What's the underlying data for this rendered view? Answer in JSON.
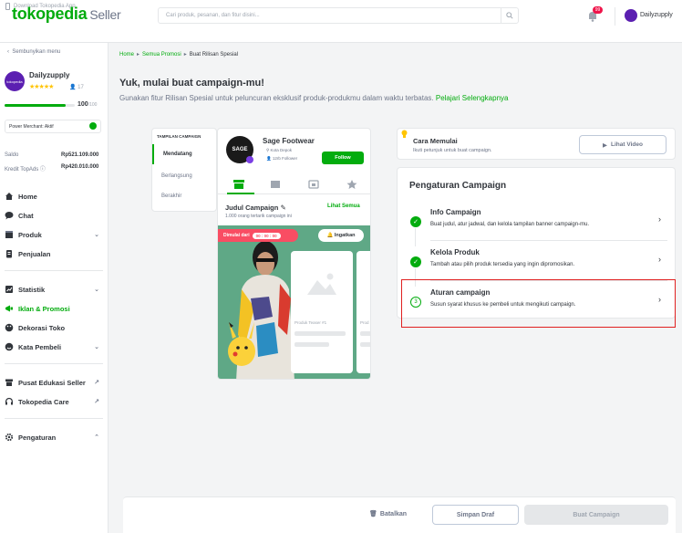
{
  "topbar": {
    "download_app": "Download Tokopedia App"
  },
  "header": {
    "logo": "tokopedia",
    "logo_suffix": "Seller",
    "search_placeholder": "Cari produk, pesanan, dan fitur disini...",
    "notification_count": "99",
    "user_name": "Dailyzupply",
    "avatar_text": "tokopedia"
  },
  "sidebar": {
    "hide_menu": "Sembunyikan menu",
    "shop_name": "Dailyzupply",
    "stars": "★★★★★",
    "followers": "17",
    "score": "100",
    "score_max": "/100",
    "power_merchant": "Power Merchant: Aktif",
    "saldo_label": "Saldo",
    "saldo_value": "Rp521.109.000",
    "kredit_label": "Kredit TopAds",
    "kredit_value": "Rp420.010.000",
    "items": [
      {
        "label": "Home",
        "icon": "home-icon"
      },
      {
        "label": "Chat",
        "icon": "chat-icon"
      },
      {
        "label": "Produk",
        "icon": "box-icon"
      },
      {
        "label": "Penjualan",
        "icon": "clipboard-icon"
      },
      {
        "label": "Statistik",
        "icon": "chart-icon"
      },
      {
        "label": "Iklan & Promosi",
        "icon": "megaphone-icon"
      },
      {
        "label": "Dekorasi Toko",
        "icon": "palette-icon"
      },
      {
        "label": "Kata Pembeli",
        "icon": "smile-icon"
      },
      {
        "label": "Pusat Edukasi Seller",
        "icon": "store-icon"
      },
      {
        "label": "Tokopedia Care",
        "icon": "headset-icon"
      },
      {
        "label": "Pengaturan",
        "icon": "gear-icon"
      }
    ]
  },
  "breadcrumb": {
    "home": "Home",
    "semua_promosi": "Semua Promosi",
    "current": "Buat Rilisan Spesial"
  },
  "main": {
    "title": "Yuk, mulai buat campaign-mu!",
    "subtitle": "Gunakan fitur Rilisan Spesial untuk peluncuran eksklusif produk-produkmu dalam waktu terbatas.",
    "learn_more": "Pelajari Selengkapnya"
  },
  "preview": {
    "tabs_header": "TAMPILAN CAMPAIGN",
    "tabs": [
      "Mendatang",
      "Berlangsung",
      "Berakhir"
    ],
    "shop_name": "Sage Footwear",
    "shop_logo": "SAGE",
    "location": "Kota Depok",
    "followers": "12rb Follower",
    "follow": "Follow",
    "campaign_title": "Judul Campaign",
    "campaign_sub": "1.000 orang tertarik campaign ini",
    "see_all": "Lihat Semua",
    "started": "Dimulai dari",
    "timer": "00 : 00 : 00",
    "remind": "Ingatkan",
    "product_teaser": "Produk Teaser #1",
    "product_teaser_2": "Prod"
  },
  "cara": {
    "title": "Cara Memulai",
    "subtitle": "Ikuti petunjuk untuk buat campaign.",
    "video_button": "Lihat Video"
  },
  "pengaturan": {
    "title": "Pengaturan Campaign",
    "steps": [
      {
        "title": "Info Campaign",
        "desc": "Buat judul, atur jadwal, dan kelola tampilan banner campaign-mu.",
        "status": "done"
      },
      {
        "title": "Kelola Produk",
        "desc": "Tambah atau pilih produk tersedia yang ingin dipromosikan.",
        "status": "done"
      },
      {
        "title": "Aturan campaign",
        "desc": "Susun syarat khusus ke pembeli untuk mengikuti campaign.",
        "status": "3"
      }
    ]
  },
  "footer": {
    "cancel": "Batalkan",
    "save_draft": "Simpan Draf",
    "create": "Buat Campaign"
  },
  "colors": {
    "brand": "#03ac0e",
    "highlight": "#e02020",
    "accent_red": "#f94d63"
  }
}
